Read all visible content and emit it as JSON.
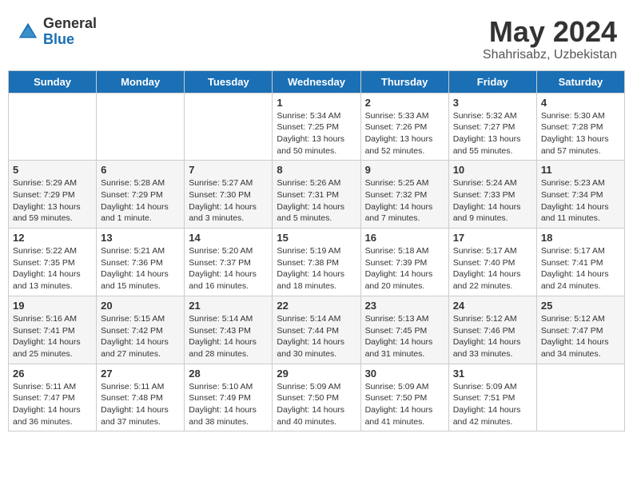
{
  "header": {
    "logo": {
      "general": "General",
      "blue": "Blue"
    },
    "title": "May 2024",
    "location": "Shahrisabz, Uzbekistan"
  },
  "weekdays": [
    "Sunday",
    "Monday",
    "Tuesday",
    "Wednesday",
    "Thursday",
    "Friday",
    "Saturday"
  ],
  "weeks": [
    [
      {
        "day": "",
        "sunrise": "",
        "sunset": "",
        "daylight": ""
      },
      {
        "day": "",
        "sunrise": "",
        "sunset": "",
        "daylight": ""
      },
      {
        "day": "",
        "sunrise": "",
        "sunset": "",
        "daylight": ""
      },
      {
        "day": "1",
        "sunrise": "Sunrise: 5:34 AM",
        "sunset": "Sunset: 7:25 PM",
        "daylight": "Daylight: 13 hours and 50 minutes."
      },
      {
        "day": "2",
        "sunrise": "Sunrise: 5:33 AM",
        "sunset": "Sunset: 7:26 PM",
        "daylight": "Daylight: 13 hours and 52 minutes."
      },
      {
        "day": "3",
        "sunrise": "Sunrise: 5:32 AM",
        "sunset": "Sunset: 7:27 PM",
        "daylight": "Daylight: 13 hours and 55 minutes."
      },
      {
        "day": "4",
        "sunrise": "Sunrise: 5:30 AM",
        "sunset": "Sunset: 7:28 PM",
        "daylight": "Daylight: 13 hours and 57 minutes."
      }
    ],
    [
      {
        "day": "5",
        "sunrise": "Sunrise: 5:29 AM",
        "sunset": "Sunset: 7:29 PM",
        "daylight": "Daylight: 13 hours and 59 minutes."
      },
      {
        "day": "6",
        "sunrise": "Sunrise: 5:28 AM",
        "sunset": "Sunset: 7:29 PM",
        "daylight": "Daylight: 14 hours and 1 minute."
      },
      {
        "day": "7",
        "sunrise": "Sunrise: 5:27 AM",
        "sunset": "Sunset: 7:30 PM",
        "daylight": "Daylight: 14 hours and 3 minutes."
      },
      {
        "day": "8",
        "sunrise": "Sunrise: 5:26 AM",
        "sunset": "Sunset: 7:31 PM",
        "daylight": "Daylight: 14 hours and 5 minutes."
      },
      {
        "day": "9",
        "sunrise": "Sunrise: 5:25 AM",
        "sunset": "Sunset: 7:32 PM",
        "daylight": "Daylight: 14 hours and 7 minutes."
      },
      {
        "day": "10",
        "sunrise": "Sunrise: 5:24 AM",
        "sunset": "Sunset: 7:33 PM",
        "daylight": "Daylight: 14 hours and 9 minutes."
      },
      {
        "day": "11",
        "sunrise": "Sunrise: 5:23 AM",
        "sunset": "Sunset: 7:34 PM",
        "daylight": "Daylight: 14 hours and 11 minutes."
      }
    ],
    [
      {
        "day": "12",
        "sunrise": "Sunrise: 5:22 AM",
        "sunset": "Sunset: 7:35 PM",
        "daylight": "Daylight: 14 hours and 13 minutes."
      },
      {
        "day": "13",
        "sunrise": "Sunrise: 5:21 AM",
        "sunset": "Sunset: 7:36 PM",
        "daylight": "Daylight: 14 hours and 15 minutes."
      },
      {
        "day": "14",
        "sunrise": "Sunrise: 5:20 AM",
        "sunset": "Sunset: 7:37 PM",
        "daylight": "Daylight: 14 hours and 16 minutes."
      },
      {
        "day": "15",
        "sunrise": "Sunrise: 5:19 AM",
        "sunset": "Sunset: 7:38 PM",
        "daylight": "Daylight: 14 hours and 18 minutes."
      },
      {
        "day": "16",
        "sunrise": "Sunrise: 5:18 AM",
        "sunset": "Sunset: 7:39 PM",
        "daylight": "Daylight: 14 hours and 20 minutes."
      },
      {
        "day": "17",
        "sunrise": "Sunrise: 5:17 AM",
        "sunset": "Sunset: 7:40 PM",
        "daylight": "Daylight: 14 hours and 22 minutes."
      },
      {
        "day": "18",
        "sunrise": "Sunrise: 5:17 AM",
        "sunset": "Sunset: 7:41 PM",
        "daylight": "Daylight: 14 hours and 24 minutes."
      }
    ],
    [
      {
        "day": "19",
        "sunrise": "Sunrise: 5:16 AM",
        "sunset": "Sunset: 7:41 PM",
        "daylight": "Daylight: 14 hours and 25 minutes."
      },
      {
        "day": "20",
        "sunrise": "Sunrise: 5:15 AM",
        "sunset": "Sunset: 7:42 PM",
        "daylight": "Daylight: 14 hours and 27 minutes."
      },
      {
        "day": "21",
        "sunrise": "Sunrise: 5:14 AM",
        "sunset": "Sunset: 7:43 PM",
        "daylight": "Daylight: 14 hours and 28 minutes."
      },
      {
        "day": "22",
        "sunrise": "Sunrise: 5:14 AM",
        "sunset": "Sunset: 7:44 PM",
        "daylight": "Daylight: 14 hours and 30 minutes."
      },
      {
        "day": "23",
        "sunrise": "Sunrise: 5:13 AM",
        "sunset": "Sunset: 7:45 PM",
        "daylight": "Daylight: 14 hours and 31 minutes."
      },
      {
        "day": "24",
        "sunrise": "Sunrise: 5:12 AM",
        "sunset": "Sunset: 7:46 PM",
        "daylight": "Daylight: 14 hours and 33 minutes."
      },
      {
        "day": "25",
        "sunrise": "Sunrise: 5:12 AM",
        "sunset": "Sunset: 7:47 PM",
        "daylight": "Daylight: 14 hours and 34 minutes."
      }
    ],
    [
      {
        "day": "26",
        "sunrise": "Sunrise: 5:11 AM",
        "sunset": "Sunset: 7:47 PM",
        "daylight": "Daylight: 14 hours and 36 minutes."
      },
      {
        "day": "27",
        "sunrise": "Sunrise: 5:11 AM",
        "sunset": "Sunset: 7:48 PM",
        "daylight": "Daylight: 14 hours and 37 minutes."
      },
      {
        "day": "28",
        "sunrise": "Sunrise: 5:10 AM",
        "sunset": "Sunset: 7:49 PM",
        "daylight": "Daylight: 14 hours and 38 minutes."
      },
      {
        "day": "29",
        "sunrise": "Sunrise: 5:09 AM",
        "sunset": "Sunset: 7:50 PM",
        "daylight": "Daylight: 14 hours and 40 minutes."
      },
      {
        "day": "30",
        "sunrise": "Sunrise: 5:09 AM",
        "sunset": "Sunset: 7:50 PM",
        "daylight": "Daylight: 14 hours and 41 minutes."
      },
      {
        "day": "31",
        "sunrise": "Sunrise: 5:09 AM",
        "sunset": "Sunset: 7:51 PM",
        "daylight": "Daylight: 14 hours and 42 minutes."
      },
      {
        "day": "",
        "sunrise": "",
        "sunset": "",
        "daylight": ""
      }
    ]
  ]
}
